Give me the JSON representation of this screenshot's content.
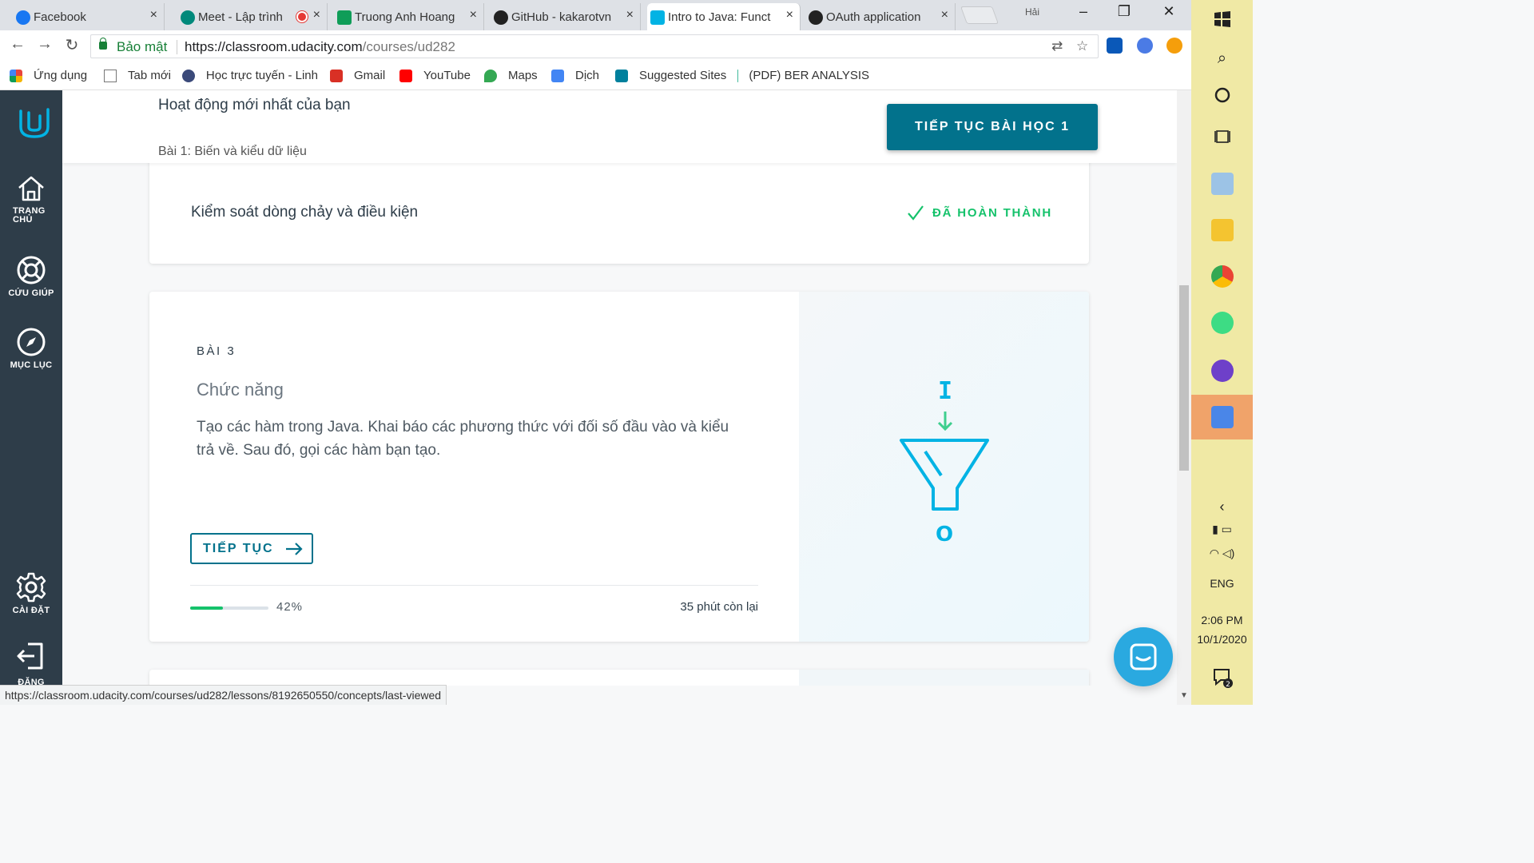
{
  "browser": {
    "tabs": [
      {
        "label": "Facebook",
        "icon": "facebook-icon",
        "color": "#1877f2"
      },
      {
        "label": "Meet - Lập trình",
        "icon": "meet-icon",
        "color": "#00897b"
      },
      {
        "label": "Truong Anh Hoang",
        "icon": "sheets-icon",
        "color": "#0f9d58"
      },
      {
        "label": "GitHub - kakarotvn",
        "icon": "github-icon",
        "color": "#222222"
      },
      {
        "label": "Intro to Java: Funct",
        "icon": "udacity-icon",
        "color": "#02b3e4"
      },
      {
        "label": "OAuth application",
        "icon": "github-icon",
        "color": "#222222"
      }
    ],
    "user": "Hải",
    "secure_label": "Bảo mật",
    "url_host": "https://classroom.udacity.com",
    "url_path": "/courses/ud282",
    "bookmarks": [
      {
        "label": "Ứng dụng",
        "icon": "apps-icon",
        "color": "#e8453c"
      },
      {
        "label": "Tab mới",
        "icon": "page-icon",
        "color": "#ffffff"
      },
      {
        "label": "Học trực tuyến - Linh",
        "icon": "b-icon",
        "color": "#3b4a7a"
      },
      {
        "label": "Gmail",
        "icon": "gmail-icon",
        "color": "#d93025"
      },
      {
        "label": "YouTube",
        "icon": "youtube-icon",
        "color": "#ff0000"
      },
      {
        "label": "Maps",
        "icon": "maps-icon",
        "color": "#34a853"
      },
      {
        "label": "Dịch",
        "icon": "translate-icon",
        "color": "#4285f4"
      },
      {
        "label": "Suggested Sites",
        "icon": "bing-icon",
        "color": "#00809d"
      },
      {
        "label": "(PDF) BER ANALYSIS",
        "icon": "researchgate-icon",
        "color": "#40ba9b"
      }
    ],
    "status_url": "https://classroom.udacity.com/courses/ud282/lessons/8192650550/concepts/last-viewed"
  },
  "sidebar": {
    "items": [
      {
        "label": "TRANG CHỦ",
        "icon": "home-icon"
      },
      {
        "label": "CỨU GIÚP",
        "icon": "lifebuoy-icon"
      },
      {
        "label": "MỤC LỤC",
        "icon": "compass-icon"
      },
      {
        "label": "CÀI ĐẶT",
        "icon": "gear-icon"
      },
      {
        "label": "ĐĂNG",
        "icon": "logout-icon"
      }
    ]
  },
  "header": {
    "title": "Hoạt động mới nhất của bạn",
    "subtitle": "Bài 1: Biến và kiểu dữ liệu",
    "continue_label": "TIẾP TỤC BÀI HỌC 1"
  },
  "concept": {
    "title": "Kiểm soát dòng chảy và điều kiện",
    "status": "ĐÃ HOÀN THÀNH"
  },
  "lesson": {
    "number": "BÀI 3",
    "title": "Chức năng",
    "description": "Tạo các hàm trong Java. Khai báo các phương thức với đối số đầu vào và kiểu trả về. Sau đó, gọi các hàm bạn tạo.",
    "continue_label": "TIẾP TỤC",
    "progress": 0.42,
    "progress_label": "42%",
    "time_left": "35 phút còn lại",
    "art_input": "I",
    "art_output": "O"
  },
  "taskbar": {
    "language": "ENG",
    "time": "2:06 PM",
    "date": "10/1/2020",
    "notification_count": "2"
  },
  "colors": {
    "accent": "#02728c",
    "brand": "#02b3e4",
    "success": "#15c26b",
    "sidebar": "#2e3d49"
  }
}
